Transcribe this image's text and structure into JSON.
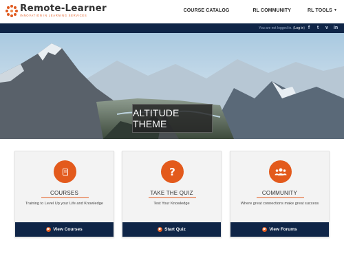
{
  "logo": {
    "name": "Remote-Learner",
    "tagline": "INNOVATION IN LEARNING SERVICES"
  },
  "nav": {
    "items": [
      {
        "label": "COURSE CATALOG"
      },
      {
        "label": "RL COMMUNITY"
      },
      {
        "label": "RL TOOLS"
      }
    ]
  },
  "topbar": {
    "login_prefix": "You are not logged in. (",
    "login_link": "Log in",
    "login_suffix": ")",
    "socials": [
      "f",
      "t",
      "v",
      "in"
    ]
  },
  "hero": {
    "title": "ALTITUDE THEME"
  },
  "cards": [
    {
      "title": "COURSES",
      "description": "Training to Level Up your Life and Knowledge",
      "button": "View Courses",
      "icon": "book-icon"
    },
    {
      "title": "TAKE THE QUIZ",
      "description": "Test Your Knowledge",
      "button": "Start Quiz",
      "icon": "question-icon"
    },
    {
      "title": "COMMUNITY",
      "description": "Where great connections make great success",
      "button": "View Forums",
      "icon": "users-icon"
    }
  ],
  "colors": {
    "accent": "#e35a1c",
    "navy": "#0f2547"
  }
}
